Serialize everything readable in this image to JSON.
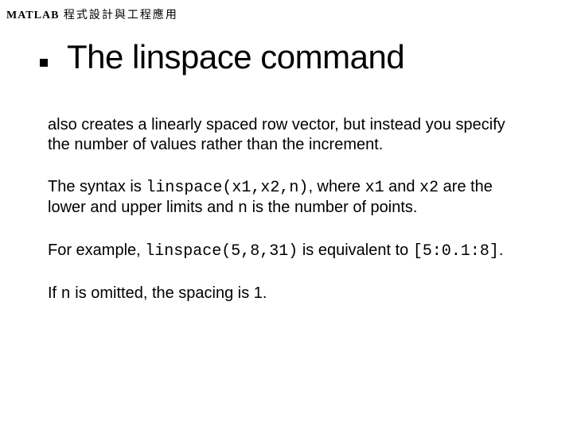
{
  "header": {
    "matlab": "MATLAB",
    "subtitle": " 程式設計與工程應用"
  },
  "title": "The linspace command",
  "body": {
    "p1": "also creates a linearly spaced row vector, but instead you specify the number of values rather than the increment.",
    "p2a": "The syntax is ",
    "p2_code1": "linspace(x1,x2,n)",
    "p2b": ", where ",
    "p2_code2": "x1",
    "p2c": " and ",
    "p2_code3": "x2",
    "p2d": " are the lower and upper limits and ",
    "p2_code4": "n",
    "p2e": " is the number of points.",
    "p3a": "For example, ",
    "p3_code1": "linspace(5,8,31)",
    "p3b": " is equivalent to ",
    "p3_code2": "[5:0.1:8]",
    "p3c": ".",
    "p4a": "If ",
    "p4_code1": "n",
    "p4b": " is omitted, the spacing is 1."
  }
}
